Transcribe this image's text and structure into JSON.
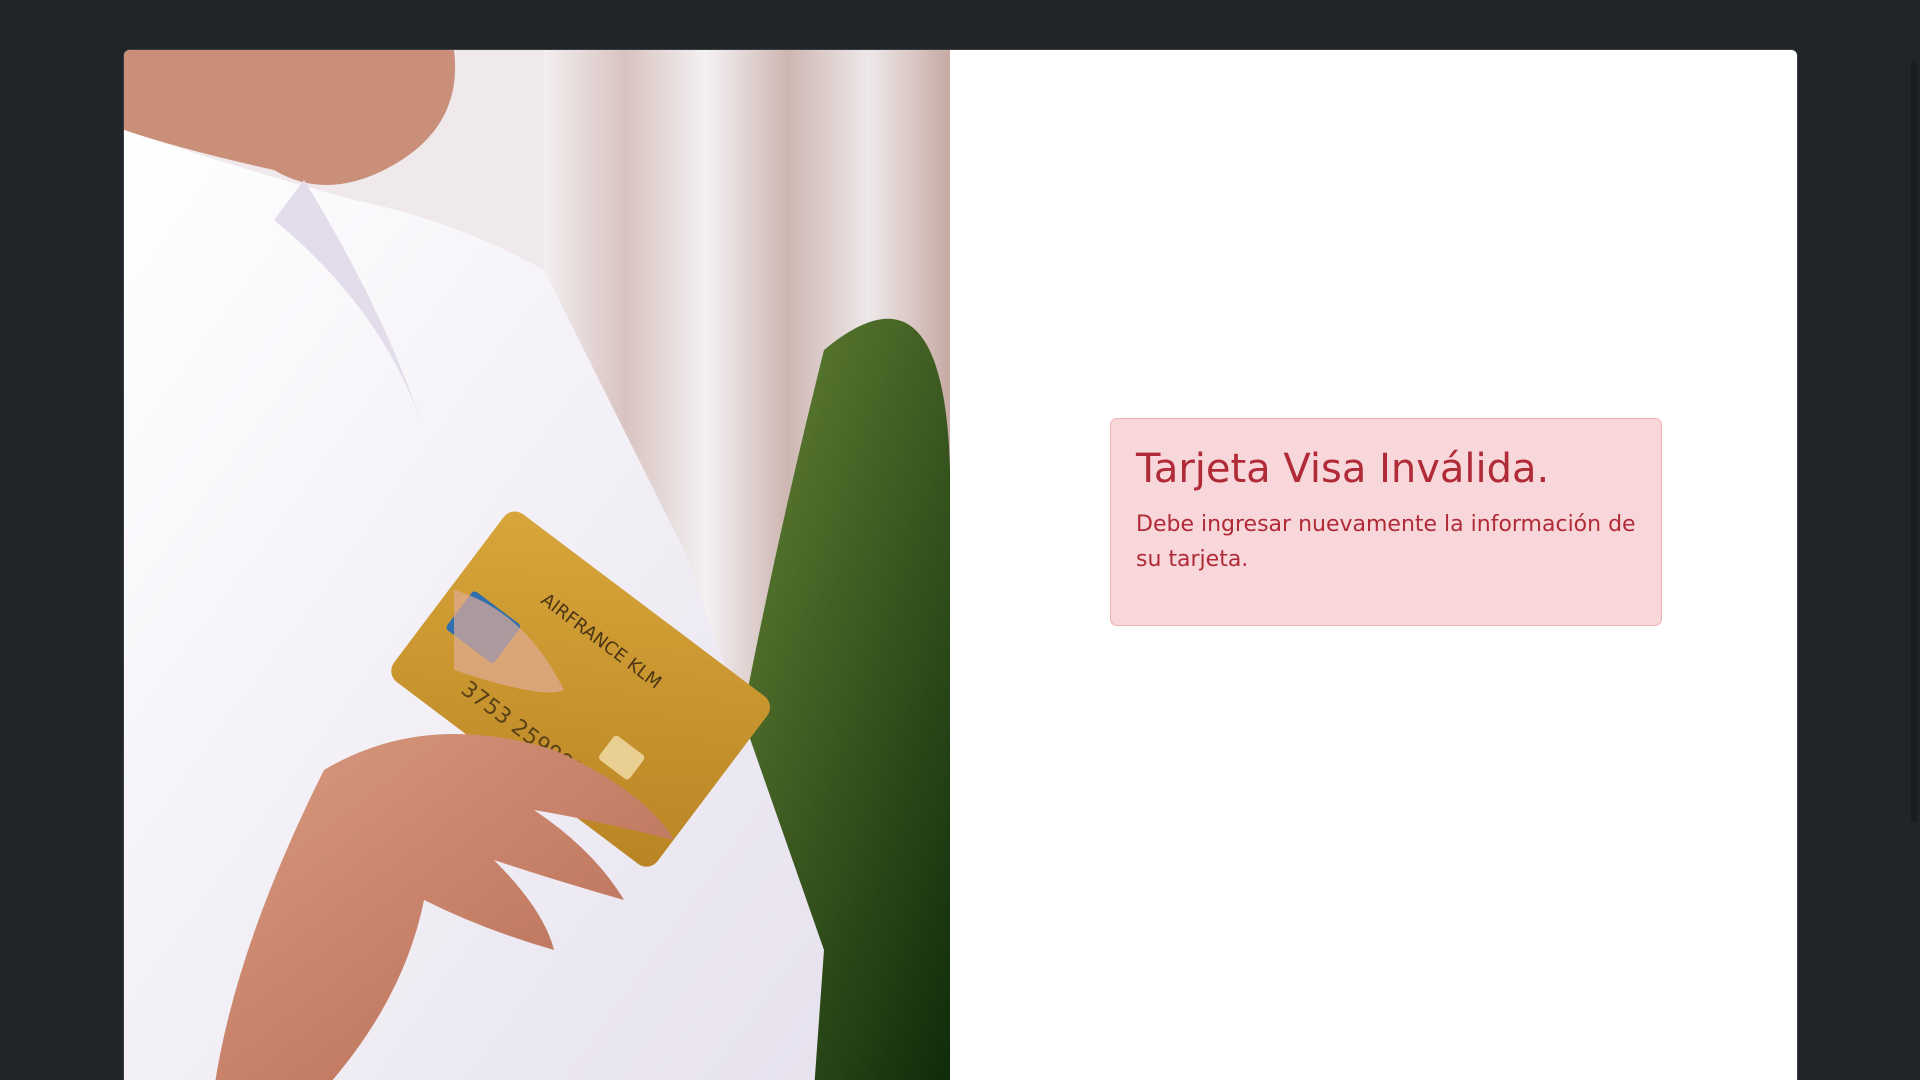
{
  "hero_image": {
    "description_icon": "person-holding-credit-card-photo"
  },
  "alert": {
    "heading": "Tarjeta Visa Inválida.",
    "message": "Debe ingresar nuevamente la información de su tarjeta.",
    "colors": {
      "background": "#f8d7da",
      "border": "#f1aeb5",
      "text": "#b02a37"
    }
  },
  "theme": {
    "page_background": "#212529",
    "card_background": "#ffffff"
  }
}
